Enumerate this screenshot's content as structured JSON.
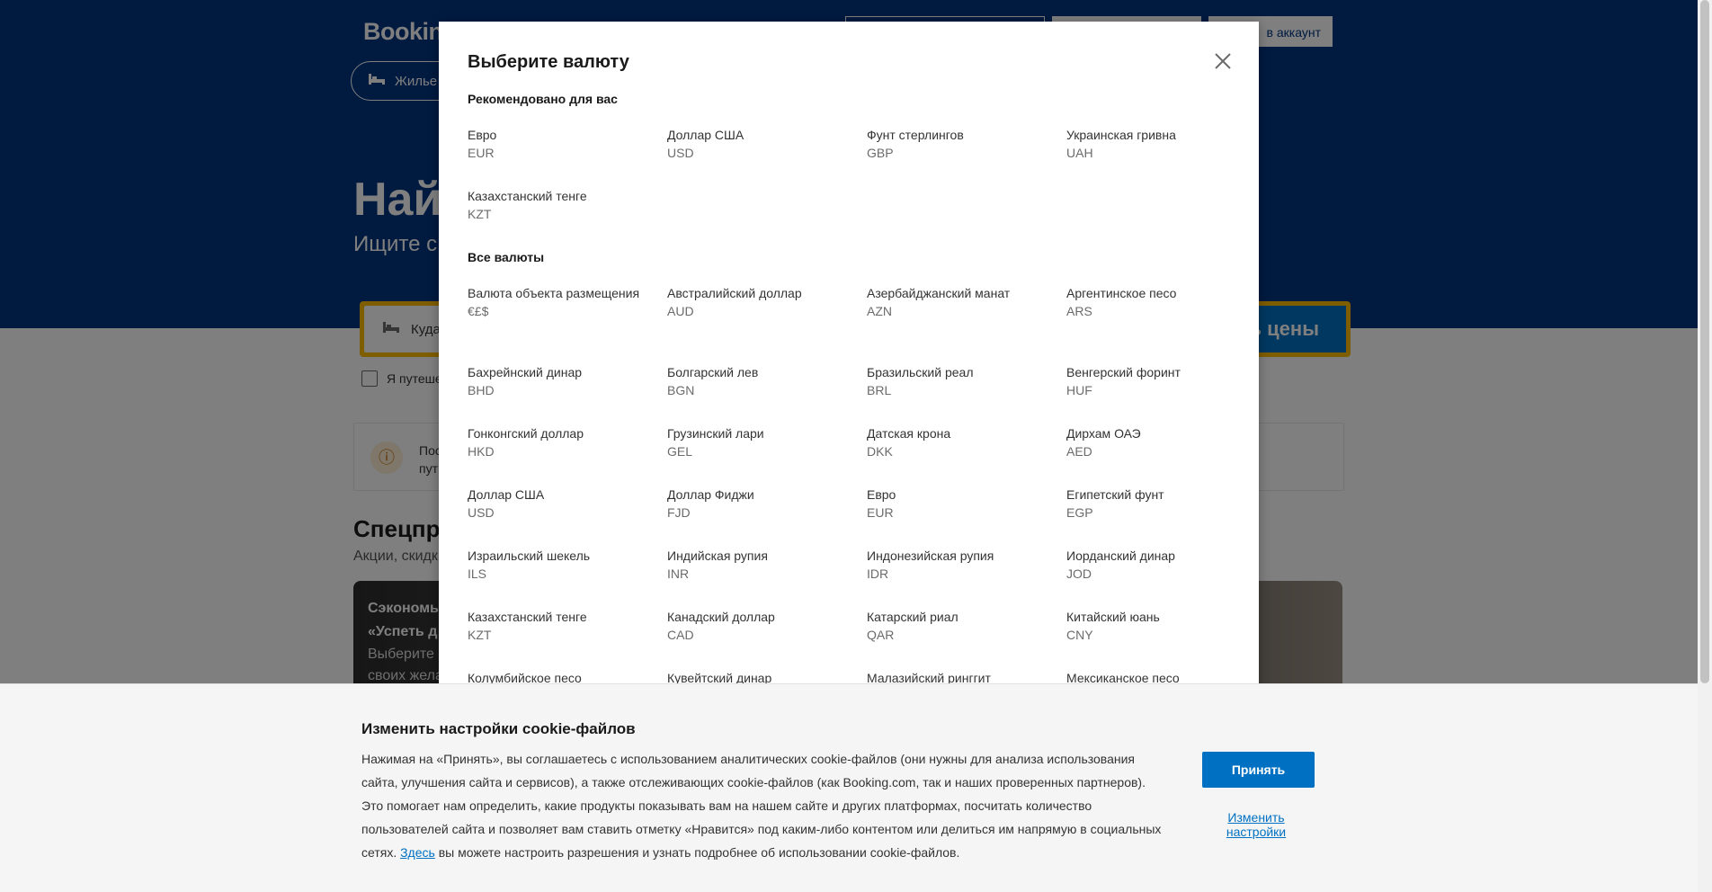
{
  "header": {
    "logo": "Booking",
    "currency_btn": "",
    "register_btn": "",
    "signin_btn": "в аккаунт",
    "stays_tab": "Жилье"
  },
  "hero": {
    "title": "Най",
    "subtitle": "Ищите с"
  },
  "search": {
    "destination_label": "Куда",
    "submit_label": "ь цены",
    "business_travel_label": "Я путеше"
  },
  "info": {
    "text_line1": "Пос",
    "text_line2": "пут",
    "icon": "info-icon"
  },
  "deals": {
    "title": "Спецпре",
    "subtitle": "Акции, скидк",
    "card_title_line1": "Сэкономь",
    "card_title_line2": "«Успеть д",
    "card_text_line1": "Выберите с",
    "card_text_line2": "своих жела"
  },
  "modal": {
    "title": "Выберите валюту",
    "recommended_heading": "Рекомендовано для вас",
    "all_heading": "Все валюты",
    "recommended": [
      {
        "name": "Евро",
        "code": "EUR"
      },
      {
        "name": "Доллар США",
        "code": "USD"
      },
      {
        "name": "Фунт стерлингов",
        "code": "GBP"
      },
      {
        "name": "Украинская гривна",
        "code": "UAH"
      },
      {
        "name": "Казахстанский тенге",
        "code": "KZT"
      }
    ],
    "all": [
      {
        "name": "Валюта объекта размещения",
        "code": "€£$"
      },
      {
        "name": "Австралийский доллар",
        "code": "AUD"
      },
      {
        "name": "Азербайджанский манат",
        "code": "AZN"
      },
      {
        "name": "Аргентинское песо",
        "code": "ARS"
      },
      {
        "name": "Бахрейнский динар",
        "code": "BHD"
      },
      {
        "name": "Болгарский лев",
        "code": "BGN"
      },
      {
        "name": "Бразильский реал",
        "code": "BRL"
      },
      {
        "name": "Венгерский форинт",
        "code": "HUF"
      },
      {
        "name": "Гонконгский доллар",
        "code": "HKD"
      },
      {
        "name": "Грузинский лари",
        "code": "GEL"
      },
      {
        "name": "Датская крона",
        "code": "DKK"
      },
      {
        "name": "Дирхам ОАЭ",
        "code": "AED"
      },
      {
        "name": "Доллар США",
        "code": "USD"
      },
      {
        "name": "Доллар Фиджи",
        "code": "FJD"
      },
      {
        "name": "Евро",
        "code": "EUR"
      },
      {
        "name": "Египетский фунт",
        "code": "EGP"
      },
      {
        "name": "Израильский шекель",
        "code": "ILS"
      },
      {
        "name": "Индийская рупия",
        "code": "INR"
      },
      {
        "name": "Индонезийская рупия",
        "code": "IDR"
      },
      {
        "name": "Иорданский динар",
        "code": "JOD"
      },
      {
        "name": "Казахстанский тенге",
        "code": "KZT"
      },
      {
        "name": "Канадский доллар",
        "code": "CAD"
      },
      {
        "name": "Катарский риал",
        "code": "QAR"
      },
      {
        "name": "Китайский юань",
        "code": "CNY"
      },
      {
        "name": "Колумбийское песо",
        "code": ""
      },
      {
        "name": "Кувейтский динар",
        "code": ""
      },
      {
        "name": "Малазийский ринггит",
        "code": ""
      },
      {
        "name": "Мексиканское песо",
        "code": ""
      }
    ]
  },
  "cookie": {
    "title": "Изменить настройки cookie-файлов",
    "text_before_link": "Нажимая на «Принять», вы соглашаетесь с использованием аналитических cookie-файлов (они нужны для анализа использования сайта, улучшения сайта и сервисов), а также отслеживающих cookie-файлов (как Booking.com, так и наших проверенных партнеров). Это помогает нам определить, какие продукты показывать вам на нашем сайте и других платформах, посчитать количество пользователей сайта и позволяет вам ставить отметку «Нравится» под каким-либо контентом или делиться им напрямую в социальных сетях. ",
    "link_text": "Здесь",
    "text_after_link": " вы можете настроить разрешения и узнать подробнее об использовании cookie-файлов.",
    "accept_label": "Принять",
    "manage_label": "Изменить настройки"
  }
}
